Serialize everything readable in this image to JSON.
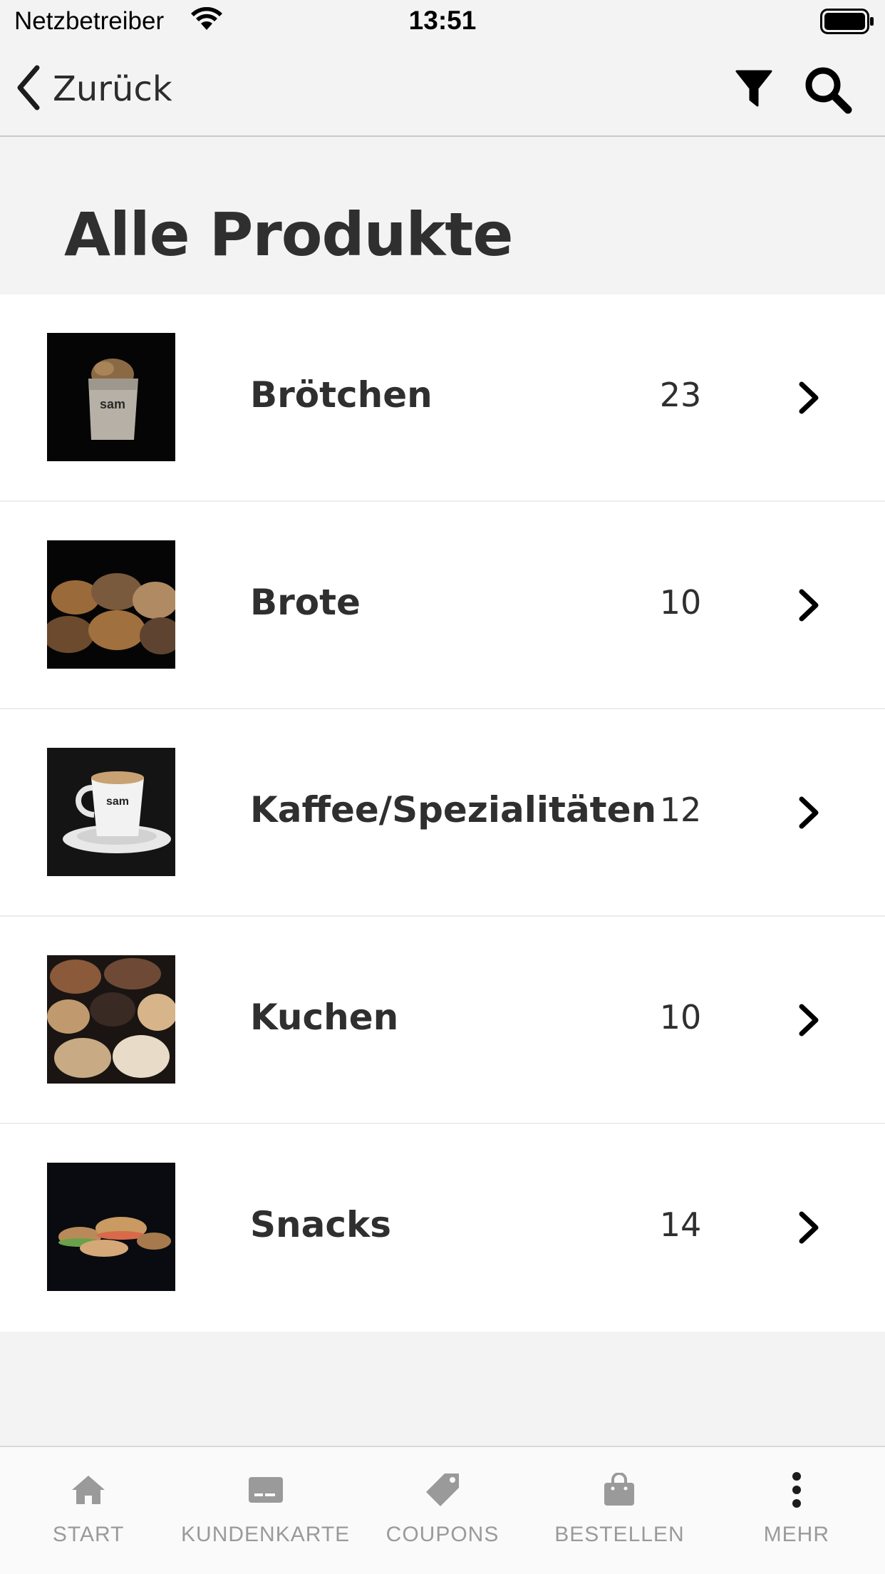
{
  "status_bar": {
    "carrier": "Netzbetreiber",
    "time": "13:51"
  },
  "nav": {
    "back_label": "Zurück"
  },
  "page": {
    "title": "Alle Produkte"
  },
  "categories": [
    {
      "label": "Brötchen",
      "count": "23",
      "image": "bread-roll-bag"
    },
    {
      "label": "Brote",
      "count": "10",
      "image": "bread-loaves"
    },
    {
      "label": "Kaffee/Spezialitäten",
      "count": "12",
      "image": "coffee-cup"
    },
    {
      "label": "Kuchen",
      "count": "10",
      "image": "pastries"
    },
    {
      "label": "Snacks",
      "count": "14",
      "image": "sandwiches"
    }
  ],
  "tabbar": {
    "items": [
      {
        "label": "START",
        "icon": "home-icon"
      },
      {
        "label": "KUNDENKARTE",
        "icon": "card-icon"
      },
      {
        "label": "COUPONS",
        "icon": "tag-icon"
      },
      {
        "label": "BESTELLEN",
        "icon": "bag-icon"
      },
      {
        "label": "MEHR",
        "icon": "more-icon"
      }
    ]
  },
  "colors": {
    "background": "#f3f3f3",
    "text": "#2f2f2f",
    "tab_inactive": "#9a9a9a"
  }
}
